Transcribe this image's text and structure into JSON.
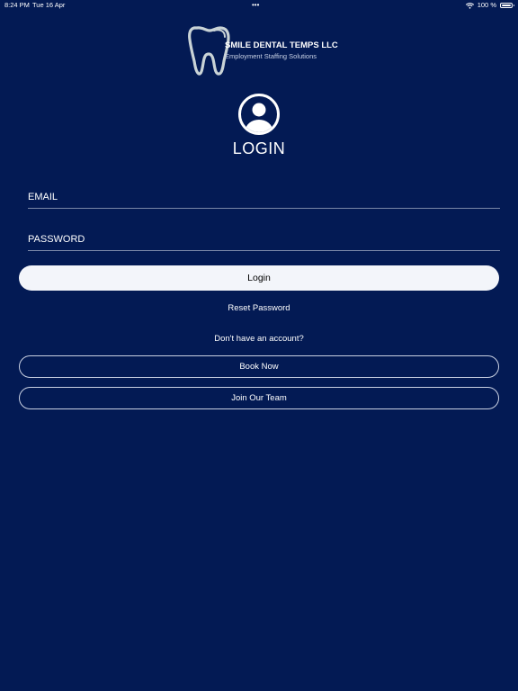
{
  "status_bar": {
    "time": "8:24 PM",
    "date": "Tue 16 Apr",
    "dots": "•••",
    "battery": "100 %",
    "battery_level": 1.0
  },
  "logo": {
    "title": "SMILE DENTAL TEMPS LLC",
    "subtitle": "Employment Staffing Solutions",
    "icon": "tooth-icon"
  },
  "avatar": {
    "icon": "user-avatar-icon"
  },
  "login": {
    "title": "LOGIN",
    "email_placeholder": "EMAIL",
    "email_value": "",
    "password_placeholder": "PASSWORD",
    "password_value": "",
    "button_label": "Login",
    "reset_label": "Reset Password"
  },
  "signup": {
    "prompt": "Don't have an account?",
    "book_label": "Book Now",
    "join_label": "Join Our Team"
  },
  "colors": {
    "background": "#031a54",
    "primary_button": "#f3f5fa",
    "text": "#ffffff"
  }
}
